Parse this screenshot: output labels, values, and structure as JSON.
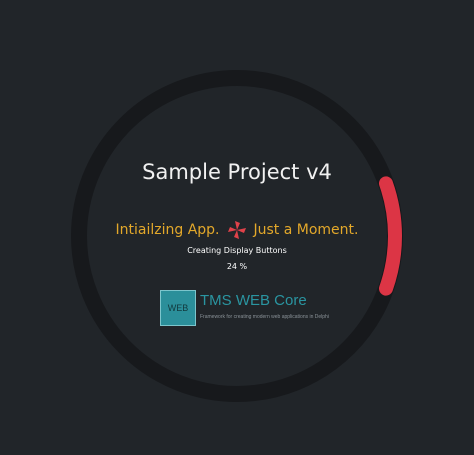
{
  "app": {
    "title": "Sample Project v4",
    "status_left": "Intiailzing App.",
    "status_right": "Just a Moment.",
    "task": "Creating Display Buttons",
    "percent_text": "24 %",
    "progress": 0.24
  },
  "brand": {
    "logo_text": "WEB",
    "name": "TMS WEB Core",
    "tagline": "Framework for creating modern web applications in Delphi"
  },
  "icons": {
    "spinner": "pinwheel-spinner-icon"
  },
  "colors": {
    "background": "#212529",
    "ring_track": "#17191c",
    "ring_progress": "#dc3545",
    "status_text": "#e3a82a",
    "brand_teal": "#2a95a1"
  }
}
